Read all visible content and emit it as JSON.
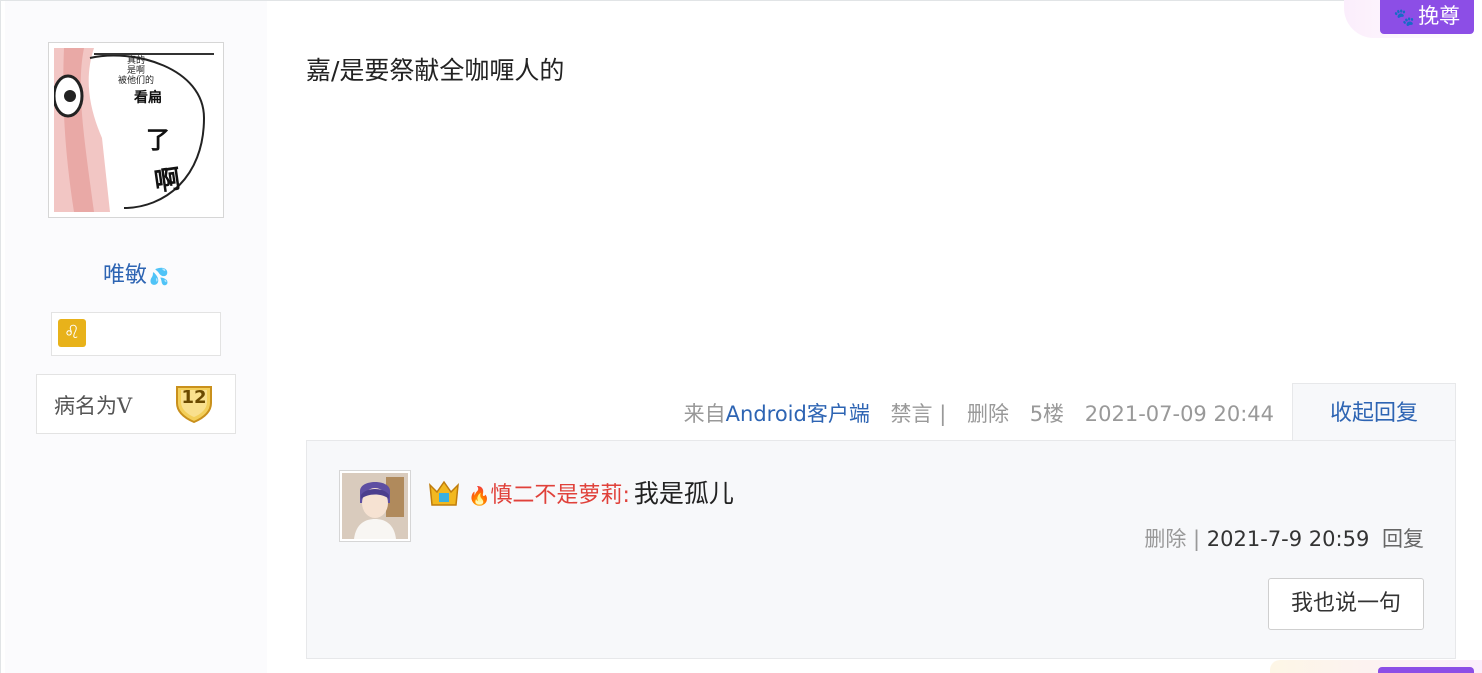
{
  "post": {
    "author": {
      "avatar_text": [
        "真的",
        "是啊",
        "被他们的",
        "看扁",
        "了",
        "啊"
      ],
      "username": "唯敏",
      "username_icon": "water-drops-icon",
      "title_badge_icon": "leo-zodiac-icon",
      "level_name": "病名为V",
      "level": "12"
    },
    "content": "嘉/是要祭献全咖喱人的",
    "tail": {
      "from_prefix": "来自",
      "client_link": "Android客户端",
      "ban": "禁言 |",
      "delete": "删除",
      "floor": "5楼",
      "time": "2021-07-09 20:44"
    },
    "collapse_label": "收起回复",
    "replies": [
      {
        "user": "慎二不是萝莉",
        "colon": ":",
        "text": "我是孤儿",
        "delete": "删除 |",
        "time": "2021-7-9 20:59",
        "reply": "回复",
        "icons": [
          "crown-badge-icon",
          "fire-icon"
        ]
      }
    ],
    "say_button": "我也说一句",
    "tag_label": "挽尊",
    "tag_icon": "paw-icon",
    "colors": {
      "link": "#2d64b3",
      "reply_user": "#e0413a",
      "tag_purple": "#8c4ee6",
      "badge_gold": "#e8b21a"
    }
  }
}
